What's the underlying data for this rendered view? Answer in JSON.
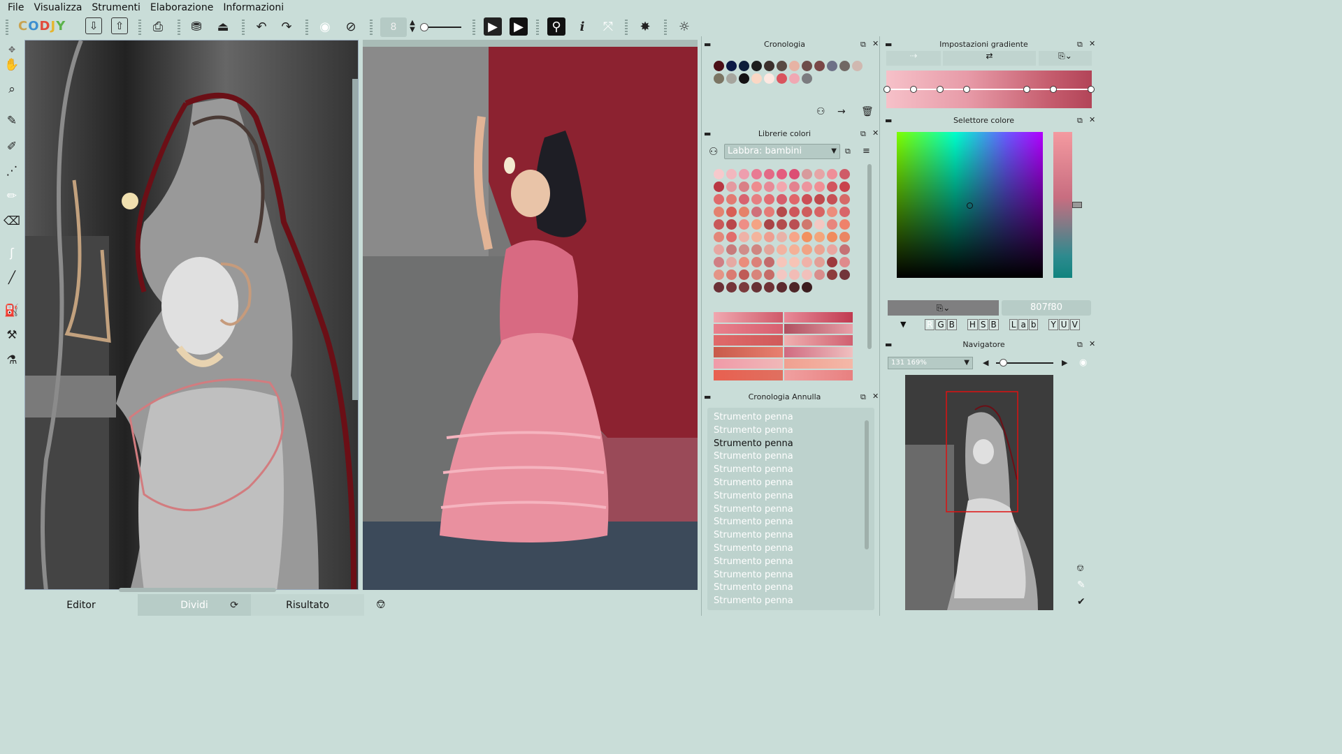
{
  "menu": [
    "File",
    "Visualizza",
    "Strumenti",
    "Elaborazione",
    "Informazioni"
  ],
  "toolbar": {
    "logo": "CODJY",
    "brush_size": "8"
  },
  "tabs": {
    "editor": "Editor",
    "split": "Dividi",
    "result": "Risultato"
  },
  "panels": {
    "history": {
      "title": "Cronologia",
      "colors": [
        "#4a0f16",
        "#0c1a45",
        "#0d1d3a",
        "#1d1d1d",
        "#3c302c",
        "#5a4b44",
        "#e7b3a4",
        "#6d4d4a",
        "#7a4747",
        "#6e7187",
        "#716864",
        "#d0b8b0",
        "#7b7563",
        "#a6a59e",
        "#141113",
        "#fbd7c4",
        "#fde8e1",
        "#d9545e",
        "#f0a8b3",
        "#7b7b7f"
      ]
    },
    "libraries": {
      "title": "Librerie colori",
      "selected": "Labbra: bambini"
    },
    "undo": {
      "title": "Cronologia Annulla",
      "items": [
        "Strumento penna",
        "Strumento penna",
        "Strumento penna",
        "Strumento penna",
        "Strumento penna",
        "Strumento penna",
        "Strumento penna",
        "Strumento penna",
        "Strumento penna",
        "Strumento penna",
        "Strumento penna",
        "Strumento penna",
        "Strumento penna",
        "Strumento penna",
        "Strumento penna"
      ],
      "current_index": 2
    },
    "gradient": {
      "title": "Impostazioni gradiente"
    },
    "picker": {
      "title": "Selettore colore",
      "hex": "807f80",
      "modes": [
        "R",
        "G",
        "B",
        "H",
        "S",
        "B",
        "L",
        "a",
        "b",
        "Y",
        "U",
        "V"
      ]
    },
    "navigator": {
      "title": "Navigatore",
      "zoom": "131 169%"
    }
  },
  "colors": {
    "bg": "#c9ddd8",
    "accent": "#9a1f2c"
  }
}
